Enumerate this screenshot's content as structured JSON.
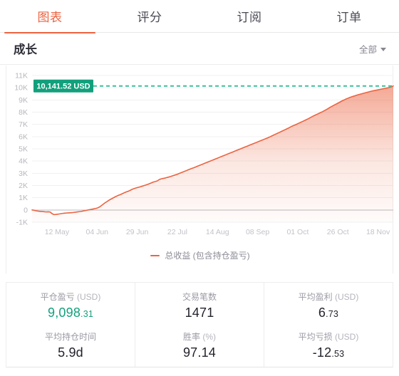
{
  "tabs": [
    {
      "label": "图表",
      "active": true
    },
    {
      "label": "评分",
      "active": false
    },
    {
      "label": "订阅",
      "active": false
    },
    {
      "label": "订单",
      "active": false
    }
  ],
  "section": {
    "title": "成长",
    "filter_label": "全部",
    "filter_icon": "chevron-down-icon"
  },
  "colors": {
    "accent": "#ec6340",
    "badge": "#12a07c",
    "dashed_line": "#3fbf9d",
    "text_primary": "#22222c",
    "text_muted": "#9b9ba5",
    "grid": "#f0f0f0"
  },
  "badge": {
    "text": "10,141.52 USD"
  },
  "legend": {
    "label": "总收益 (包含持仓盈亏)"
  },
  "stats": [
    {
      "items": [
        {
          "label": "平仓盈亏",
          "unit": "(USD)",
          "int": "9,098",
          "dec": ".31",
          "green": true
        },
        {
          "label": "平均持仓时间",
          "unit": "",
          "int": "5.9d",
          "dec": "",
          "green": false
        }
      ]
    },
    {
      "items": [
        {
          "label": "交易笔数",
          "unit": "",
          "int": "1471",
          "dec": "",
          "green": false
        },
        {
          "label": "胜率",
          "unit": "(%)",
          "int": "97.14",
          "dec": "",
          "green": false
        }
      ]
    },
    {
      "items": [
        {
          "label": "平均盈利",
          "unit": "(USD)",
          "int": "6",
          "dec": ".73",
          "green": false
        },
        {
          "label": "平均亏损",
          "unit": "(USD)",
          "int": "-12",
          "dec": ".53",
          "green": false
        }
      ]
    }
  ],
  "chart_data": {
    "type": "area",
    "title": "成长",
    "xlabel": "",
    "ylabel": "",
    "grid": true,
    "legend_position": "bottom",
    "ylim": [
      -1000,
      11000
    ],
    "yticks": [
      11000,
      10000,
      9000,
      8000,
      7000,
      6000,
      5000,
      4000,
      3000,
      2000,
      1000,
      0,
      -1000
    ],
    "ytick_labels": [
      "11K",
      "10K",
      "9K",
      "8K",
      "7K",
      "6K",
      "5K",
      "4K",
      "3K",
      "2K",
      "1K",
      "0",
      "-1K"
    ],
    "xtick_labels": [
      "12 May",
      "04 Jun",
      "29 Jun",
      "22 Jul",
      "14 Aug",
      "08 Sep",
      "01 Oct",
      "26 Oct",
      "18 Nov"
    ],
    "reference_line": {
      "value": 10141.52,
      "label": "10,141.52 USD",
      "style": "dashed",
      "color": "#3fbf9d"
    },
    "series": [
      {
        "name": "总收益 (包含持仓盈亏)",
        "color": "#ec6340",
        "fill": true,
        "values": [
          0,
          -20,
          -60,
          -90,
          -110,
          -120,
          -130,
          -150,
          -160,
          -150,
          -170,
          -300,
          -380,
          -370,
          -350,
          -330,
          -300,
          -280,
          -260,
          -250,
          -240,
          -230,
          -220,
          -200,
          -180,
          -160,
          -140,
          -120,
          -90,
          -60,
          -30,
          0,
          30,
          60,
          90,
          120,
          160,
          230,
          330,
          450,
          560,
          660,
          760,
          850,
          930,
          1010,
          1090,
          1160,
          1220,
          1280,
          1350,
          1420,
          1480,
          1530,
          1600,
          1680,
          1740,
          1790,
          1830,
          1870,
          1910,
          1960,
          2010,
          2060,
          2110,
          2170,
          2230,
          2290,
          2330,
          2380,
          2480,
          2540,
          2570,
          2600,
          2640,
          2680,
          2720,
          2770,
          2820,
          2870,
          2920,
          2980,
          3040,
          3100,
          3160,
          3220,
          3280,
          3340,
          3400,
          3450,
          3510,
          3570,
          3630,
          3690,
          3750,
          3810,
          3870,
          3930,
          3990,
          4050,
          4110,
          4170,
          4230,
          4290,
          4350,
          4410,
          4470,
          4530,
          4590,
          4650,
          4710,
          4770,
          4830,
          4890,
          4950,
          5010,
          5070,
          5130,
          5190,
          5250,
          5310,
          5370,
          5430,
          5490,
          5550,
          5610,
          5670,
          5730,
          5790,
          5850,
          5910,
          5980,
          6050,
          6120,
          6190,
          6260,
          6330,
          6400,
          6470,
          6540,
          6610,
          6680,
          6760,
          6840,
          6900,
          6960,
          7030,
          7100,
          7170,
          7240,
          7310,
          7380,
          7450,
          7530,
          7610,
          7690,
          7760,
          7830,
          7900,
          7970,
          8040,
          8120,
          8200,
          8290,
          8380,
          8460,
          8540,
          8620,
          8700,
          8780,
          8860,
          8940,
          9010,
          9080,
          9140,
          9200,
          9250,
          9300,
          9350,
          9400,
          9440,
          9480,
          9520,
          9560,
          9600,
          9640,
          9680,
          9720,
          9750,
          9780,
          9810,
          9840,
          9870,
          9900,
          9930,
          9960,
          9990,
          10030,
          10080,
          10141
        ]
      }
    ]
  }
}
